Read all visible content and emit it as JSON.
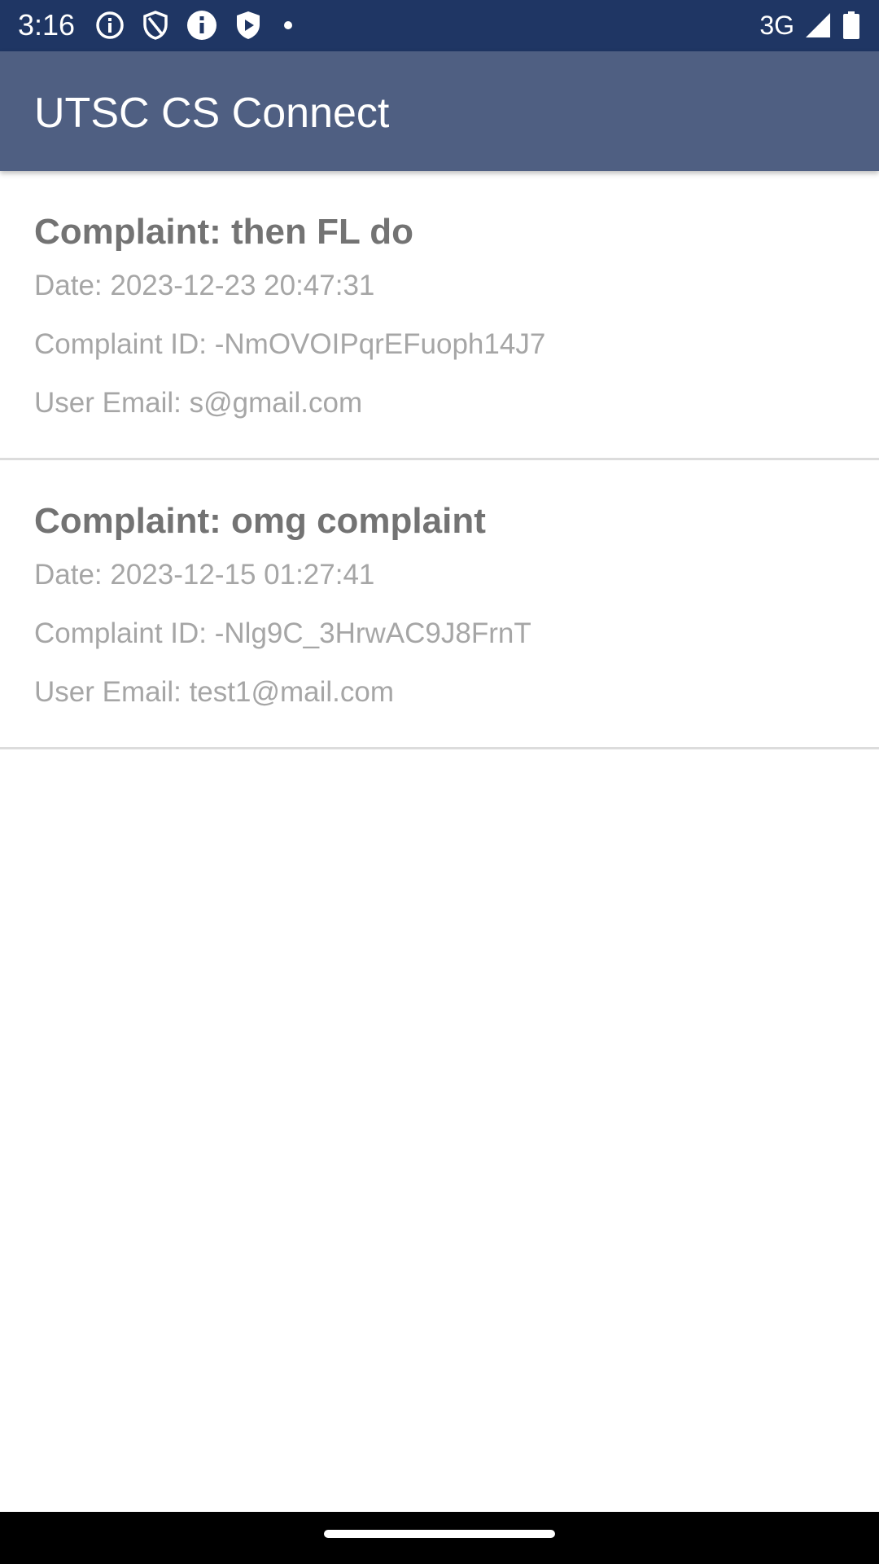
{
  "status_bar": {
    "time": "3:16",
    "network": "3G",
    "icons": [
      "info-outline-icon",
      "shield-icon",
      "info-filled-icon",
      "play-shield-icon",
      "dot-icon",
      "signal-icon",
      "battery-icon"
    ]
  },
  "app_bar": {
    "title": "UTSC CS Connect",
    "color": "#4f5f82"
  },
  "complaints": [
    {
      "title": "Complaint: then FL do",
      "date": "Date: 2023-12-23 20:47:31",
      "id": "Complaint ID: -NmOVOIPqrEFuoph14J7",
      "email": "User Email: s@gmail.com"
    },
    {
      "title": "Complaint: omg complaint",
      "date": "Date: 2023-12-15 01:27:41",
      "id": "Complaint ID: -Nlg9C_3HrwAC9J8FrnT",
      "email": "User Email: test1@mail.com"
    }
  ]
}
